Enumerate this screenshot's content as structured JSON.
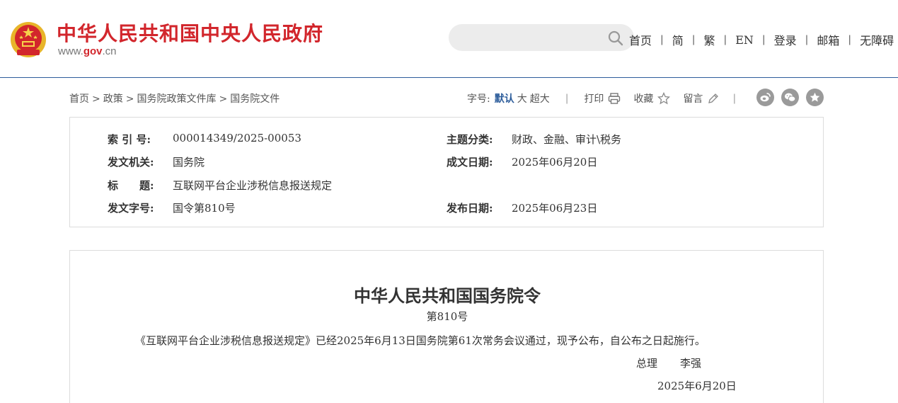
{
  "site": {
    "title": "中华人民共和国中央人民政府",
    "url_prefix": "www.",
    "url_domain": "gov",
    "url_suffix": ".cn"
  },
  "search": {
    "placeholder": ""
  },
  "topnav": [
    "首页",
    "简",
    "繁",
    "EN",
    "登录",
    "邮箱",
    "无障碍"
  ],
  "breadcrumb": [
    "首页",
    "政策",
    "国务院政策文件库",
    "国务院文件"
  ],
  "toolbar": {
    "font_label": "字号:",
    "sizes": [
      "默认",
      "大",
      "超大"
    ],
    "print": "打印",
    "favorite": "收藏",
    "comment": "留言"
  },
  "meta": {
    "index_label": "索 引 号:",
    "index_value": "000014349/2025-00053",
    "topic_label": "主题分类:",
    "topic_value": "财政、金融、审计\\税务",
    "issuer_label": "发文机关:",
    "issuer_value": "国务院",
    "written_label": "成文日期:",
    "written_value": "2025年06月20日",
    "title_label": "标　　题:",
    "title_value": "互联网平台企业涉税信息报送规定",
    "docno_label": "发文字号:",
    "docno_value": "国令第810号",
    "published_label": "发布日期:",
    "published_value": "2025年06月23日"
  },
  "document": {
    "heading": "中华人民共和国国务院令",
    "number": "第810号",
    "body": "《互联网平台企业涉税信息报送规定》已经2025年6月13日国务院第61次常务会议通过，现予公布，自公布之日起施行。",
    "signer_title": "总理",
    "signer_name": "李强",
    "date": "2025年6月20日"
  },
  "colors": {
    "brand_red": "#d2262c",
    "accent_blue": "#2d5d9b",
    "icon_gray": "#9a9a9a"
  }
}
